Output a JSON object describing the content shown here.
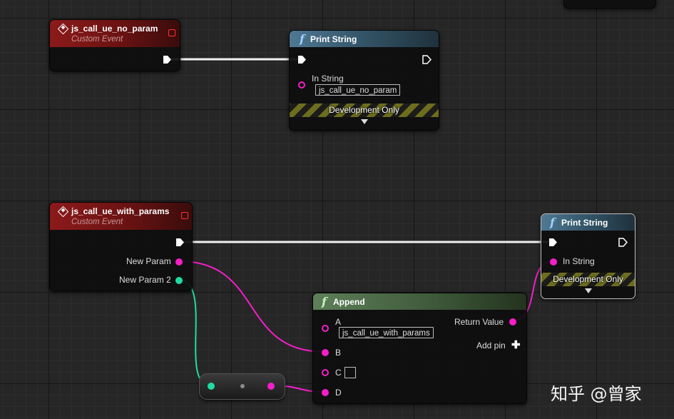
{
  "event_no_param": {
    "title": "js_call_ue_no_param",
    "subtitle": "Custom Event"
  },
  "print_string_1": {
    "title": "Print String",
    "in_string_label": "In String",
    "in_string_value": "js_call_ue_no_param",
    "dev_only": "Development Only"
  },
  "event_with_params": {
    "title": "js_call_ue_with_params",
    "subtitle": "Custom Event",
    "pin1_label": "New Param",
    "pin2_label": "New Param 2"
  },
  "print_string_2": {
    "title": "Print String",
    "in_string_label": "In String",
    "dev_only": "Development Only"
  },
  "append": {
    "title": "Append",
    "pin_a_label": "A",
    "pin_a_value": "js_call_ue_with_params",
    "pin_b_label": "B",
    "pin_c_label": "C",
    "pin_d_label": "D",
    "return_label": "Return Value",
    "add_pin_label": "Add pin"
  },
  "watermark": "知乎 @曾家",
  "colors": {
    "exec": "#ffffff",
    "string_pin": "#f51ec9",
    "name_pin": "#20dca3",
    "event_header": "#8c1a1a",
    "function_header": "#4f7893",
    "pure_header": "#5e7f59"
  }
}
